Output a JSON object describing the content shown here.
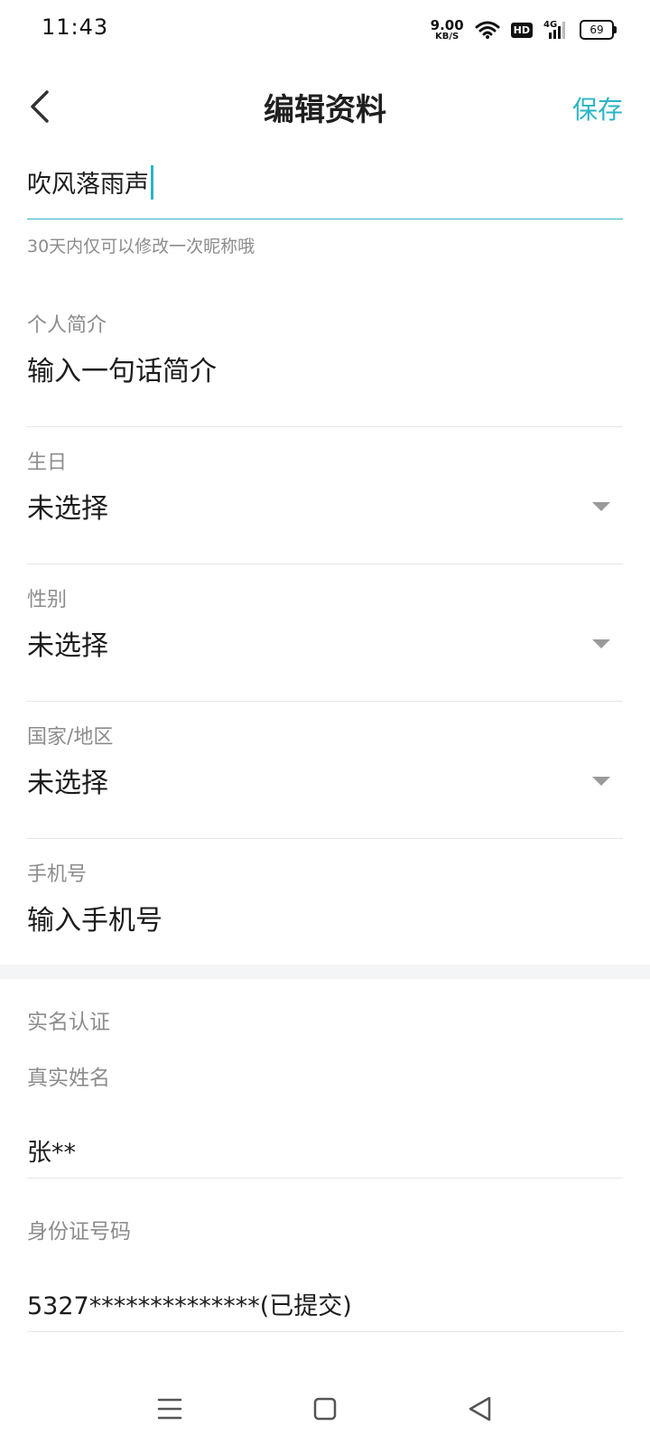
{
  "status_bar": {
    "time": "11:43",
    "net_speed": "9.00",
    "net_unit": "KB/S",
    "hd_label": "HD",
    "signal_label": "4G",
    "battery": "69"
  },
  "header": {
    "title": "编辑资料",
    "save_label": "保存",
    "accent_color": "#2bb5c4"
  },
  "nickname": {
    "value": "吹风落雨声",
    "hint": "30天内仅可以修改一次昵称哦"
  },
  "fields": {
    "bio": {
      "label": "个人简介",
      "placeholder": "输入一句话简介"
    },
    "birthday": {
      "label": "生日",
      "value": "未选择"
    },
    "gender": {
      "label": "性别",
      "value": "未选择"
    },
    "region": {
      "label": "国家/地区",
      "value": "未选择"
    },
    "phone": {
      "label": "手机号",
      "placeholder": "输入手机号"
    }
  },
  "real_name": {
    "section_title": "实名认证",
    "name_label": "真实姓名",
    "name_value": "张**",
    "id_label": "身份证号码",
    "id_value": "5327**************(已提交)"
  },
  "icons": {
    "back": "back-arrow-icon",
    "dropdown": "triangle-down-icon",
    "nav_menu": "menu-icon",
    "nav_home": "home-square-icon",
    "nav_back": "back-triangle-icon"
  }
}
